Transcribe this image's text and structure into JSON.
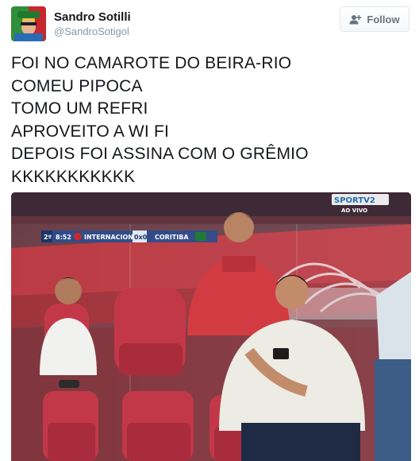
{
  "user": {
    "display_name": "Sandro Sotilli",
    "handle": "@SandroSotigol",
    "avatar_icon": "avatar-photo"
  },
  "follow_button": {
    "label": "Follow",
    "icon": "follow-person-plus-icon"
  },
  "tweet": {
    "lines": [
      "FOI NO CAMAROTE DO BEIRA-RIO",
      "COMEU PIPOCA",
      "TOMO UM REFRI",
      "APROVEITO A WI FI",
      "DEPOIS FOI ASSINA COM O GRÊMIO",
      "KKKKKKKKKKK"
    ]
  },
  "media": {
    "broadcast_logo": "SPORTV2",
    "broadcast_status": "AO VIVO",
    "scoreboard": {
      "half": "2º",
      "clock": "8:52",
      "home_team": "INTERNACIONAL",
      "score": "0x0",
      "away_team": "CORITIBA"
    }
  },
  "colors": {
    "name_text": "#14171a",
    "handle_text": "#8899a6",
    "follow_text": "#66757f",
    "follow_border": "#e1e8ed",
    "stadium_red": "#c8333a",
    "seat_red": "#c23848"
  }
}
